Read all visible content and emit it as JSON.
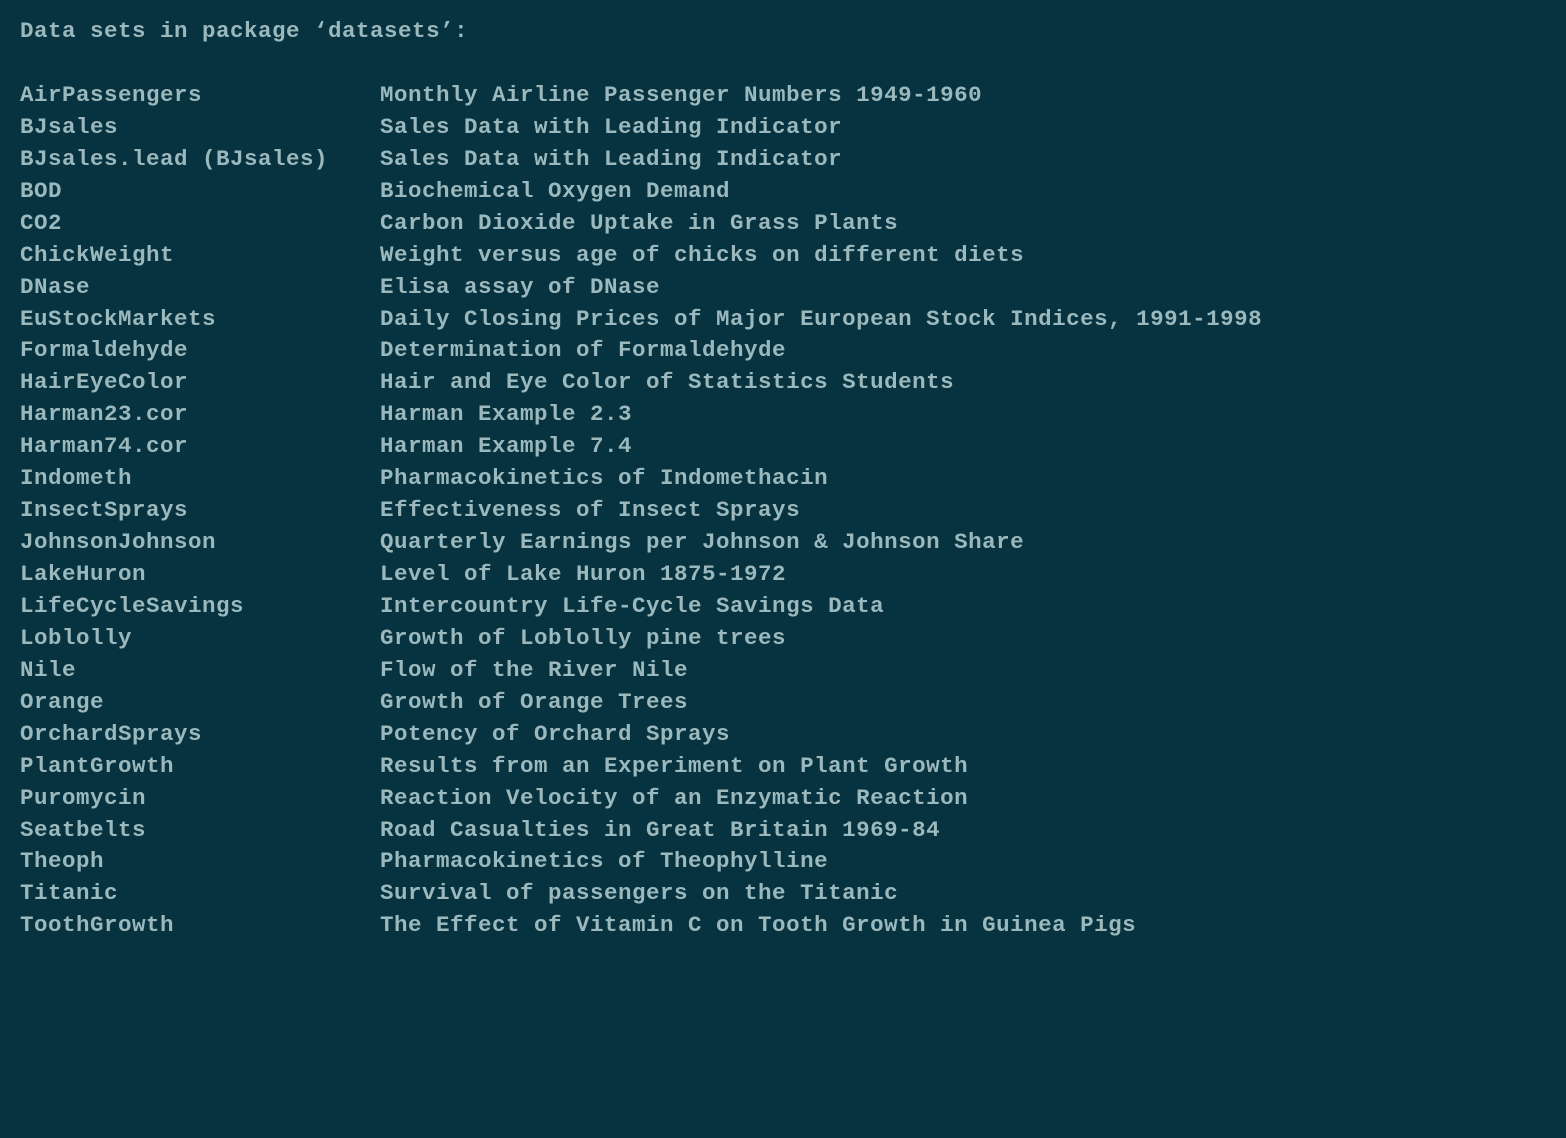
{
  "header": "Data sets in package ‘datasets’:",
  "datasets": [
    {
      "name": "AirPassengers",
      "desc": "Monthly Airline Passenger Numbers 1949-1960"
    },
    {
      "name": "BJsales",
      "desc": "Sales Data with Leading Indicator"
    },
    {
      "name": "BJsales.lead (BJsales)",
      "desc": "Sales Data with Leading Indicator"
    },
    {
      "name": "BOD",
      "desc": "Biochemical Oxygen Demand"
    },
    {
      "name": "CO2",
      "desc": "Carbon Dioxide Uptake in Grass Plants"
    },
    {
      "name": "ChickWeight",
      "desc": "Weight versus age of chicks on different diets"
    },
    {
      "name": "DNase",
      "desc": "Elisa assay of DNase"
    },
    {
      "name": "EuStockMarkets",
      "desc": "Daily Closing Prices of Major European Stock Indices, 1991-1998"
    },
    {
      "name": "Formaldehyde",
      "desc": "Determination of Formaldehyde"
    },
    {
      "name": "HairEyeColor",
      "desc": "Hair and Eye Color of Statistics Students"
    },
    {
      "name": "Harman23.cor",
      "desc": "Harman Example 2.3"
    },
    {
      "name": "Harman74.cor",
      "desc": "Harman Example 7.4"
    },
    {
      "name": "Indometh",
      "desc": "Pharmacokinetics of Indomethacin"
    },
    {
      "name": "InsectSprays",
      "desc": "Effectiveness of Insect Sprays"
    },
    {
      "name": "JohnsonJohnson",
      "desc": "Quarterly Earnings per Johnson & Johnson Share"
    },
    {
      "name": "LakeHuron",
      "desc": "Level of Lake Huron 1875-1972"
    },
    {
      "name": "LifeCycleSavings",
      "desc": "Intercountry Life-Cycle Savings Data"
    },
    {
      "name": "Loblolly",
      "desc": "Growth of Loblolly pine trees"
    },
    {
      "name": "Nile",
      "desc": "Flow of the River Nile"
    },
    {
      "name": "Orange",
      "desc": "Growth of Orange Trees"
    },
    {
      "name": "OrchardSprays",
      "desc": "Potency of Orchard Sprays"
    },
    {
      "name": "PlantGrowth",
      "desc": "Results from an Experiment on Plant Growth"
    },
    {
      "name": "Puromycin",
      "desc": "Reaction Velocity of an Enzymatic Reaction"
    },
    {
      "name": "Seatbelts",
      "desc": "Road Casualties in Great Britain 1969-84"
    },
    {
      "name": "Theoph",
      "desc": "Pharmacokinetics of Theophylline"
    },
    {
      "name": "Titanic",
      "desc": "Survival of passengers on the Titanic"
    },
    {
      "name": "ToothGrowth",
      "desc": "The Effect of Vitamin C on Tooth Growth in Guinea Pigs"
    }
  ]
}
